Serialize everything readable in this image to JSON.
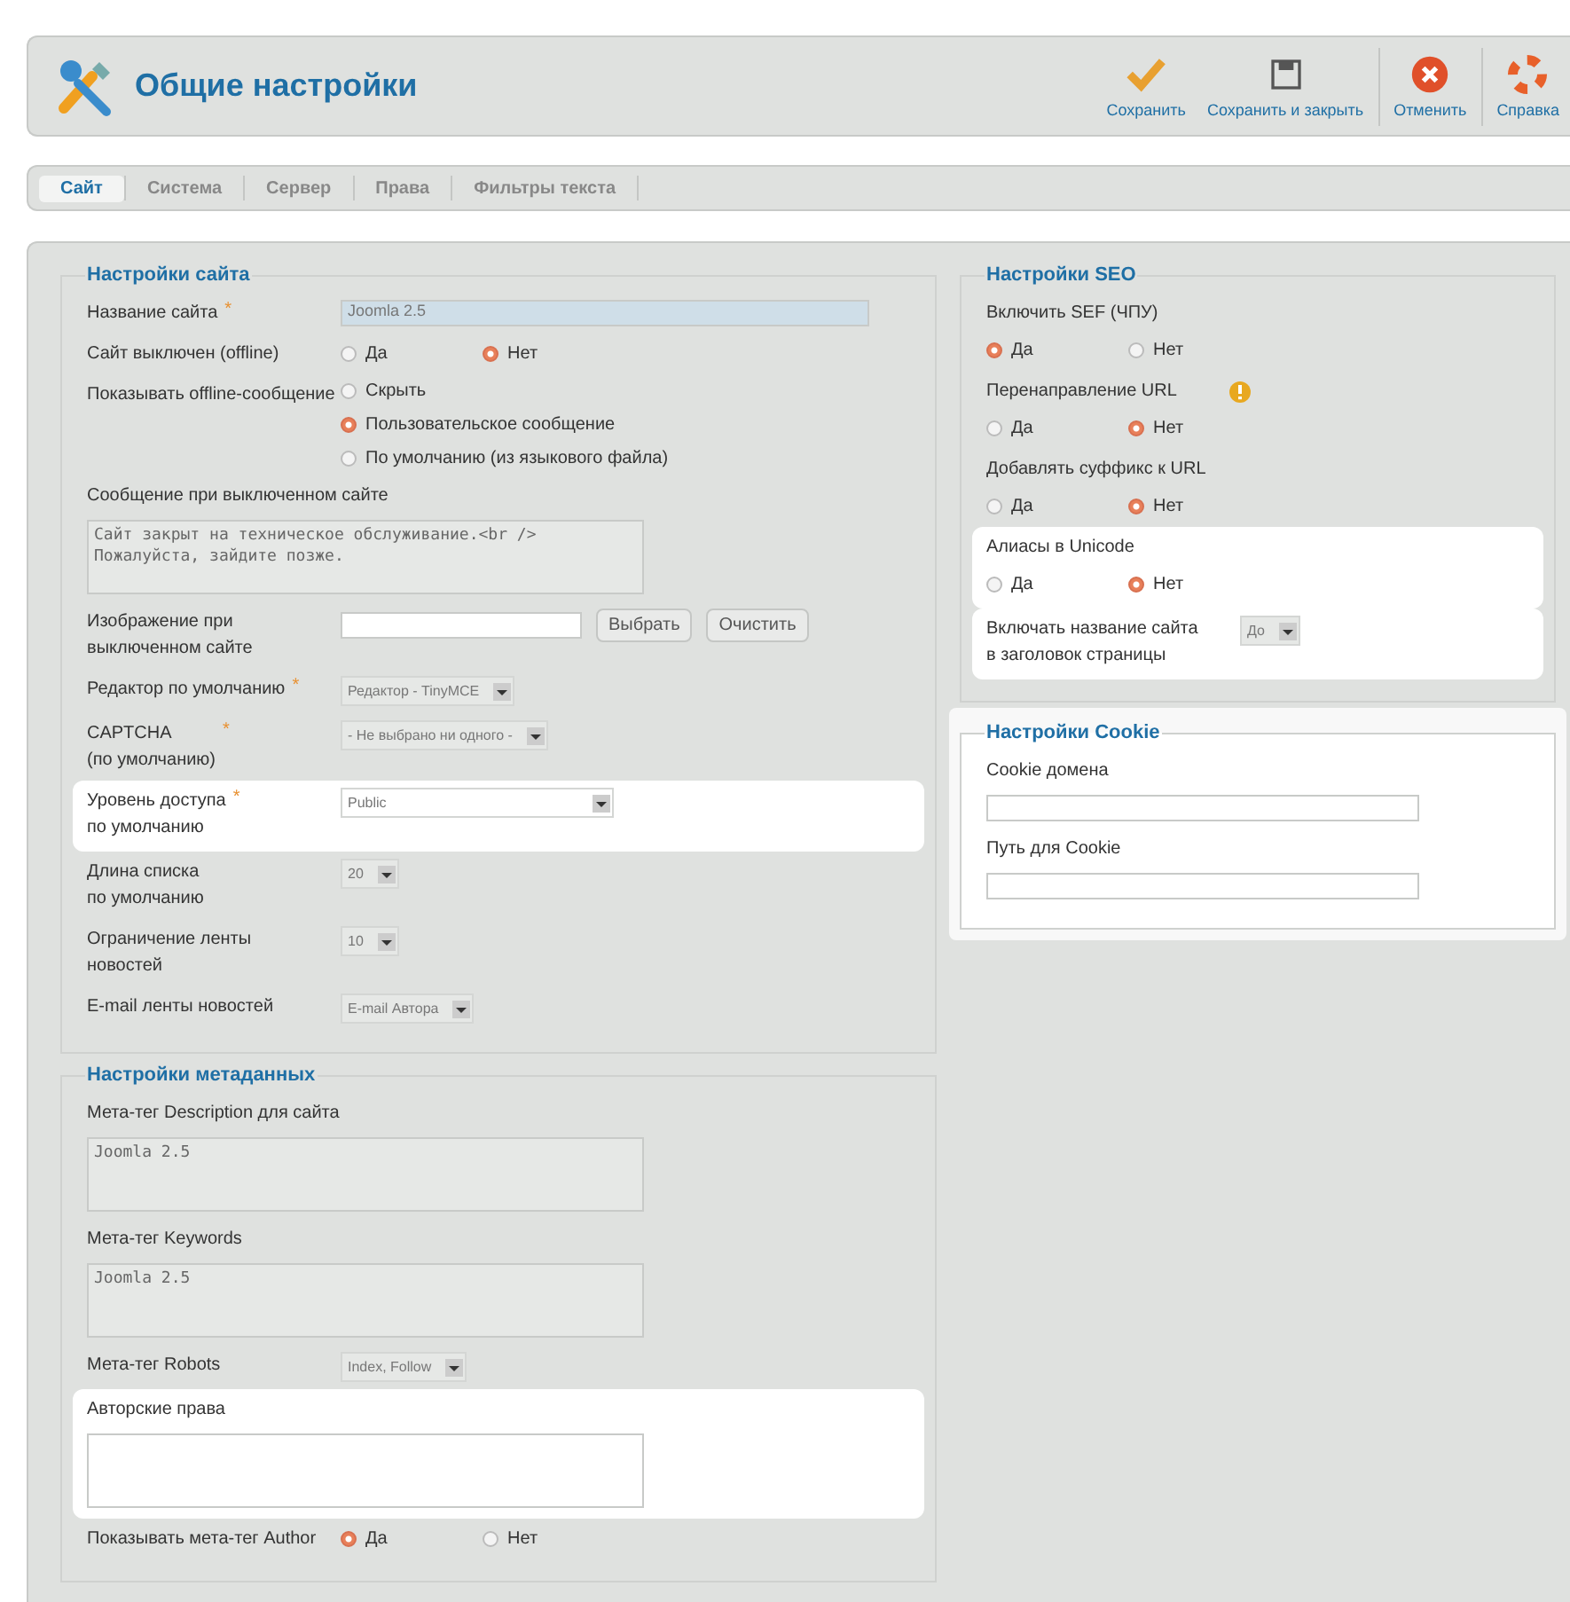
{
  "header": {
    "title": "Общие настройки",
    "toolbar": [
      {
        "kind": "save",
        "label": "Сохранить"
      },
      {
        "kind": "save-close",
        "label": "Сохранить и закрыть"
      },
      {
        "kind": "cancel",
        "label": "Отменить"
      },
      {
        "kind": "help",
        "label": "Справка"
      }
    ]
  },
  "tabs": [
    {
      "label": "Сайт",
      "selected": true
    },
    {
      "label": "Система",
      "selected": false
    },
    {
      "label": "Сервер",
      "selected": false
    },
    {
      "label": "Права",
      "selected": false
    },
    {
      "label": "Фильтры текста",
      "selected": false
    }
  ],
  "left_sections": [
    {
      "legend": "Настройки сайта",
      "highlighted": false,
      "fields": [
        {
          "kind": "text",
          "label": "Название сайта",
          "required": "*",
          "value": "Joomla 2.5"
        },
        {
          "kind": "radio",
          "label": "Сайт выключен (offline)",
          "options": [
            {
              "label": "Да",
              "selected": false
            },
            {
              "label": "Нет",
              "selected": true
            }
          ]
        },
        {
          "kind": "radio-list",
          "label": "Показывать offline-сообщение",
          "options": [
            {
              "label": "Скрыть",
              "selected": false
            },
            {
              "label": "Пользовательское сообщение",
              "selected": true
            },
            {
              "label": "По умолчанию (из языкового файла)",
              "selected": false
            }
          ]
        },
        {
          "kind": "textarea",
          "label": "Сообщение при выключенном сайте",
          "value": "Сайт закрыт на техническое обслуживание.<br />\nПожалуйста, зайдите позже."
        },
        {
          "kind": "image",
          "label": "Изображение при выключенном сайте",
          "buttons": [
            "Выбрать",
            "Очистить"
          ]
        },
        {
          "kind": "select",
          "label": "Редактор по умолчанию",
          "required": "*",
          "value": "Редактор - TinyMCE"
        },
        {
          "kind": "select",
          "label": "CAPTCHA\n(по умолчанию)",
          "required": "*",
          "value": "- Не выбрано ни одного -"
        },
        {
          "kind": "select",
          "label": "Уровень доступа\nпо умолчанию",
          "required": "*",
          "highlighted": true,
          "value": "Public"
        },
        {
          "kind": "select",
          "label": "Длина списка\nпо умолчанию",
          "value": "20"
        },
        {
          "kind": "select",
          "label": "Ограничение ленты\nновостей",
          "value": "10"
        },
        {
          "kind": "select",
          "label": "E-mail ленты новостей",
          "value": "E-mail Автора"
        }
      ]
    },
    {
      "legend": "Настройки метаданных",
      "highlighted": false,
      "fields": [
        {
          "kind": "textarea",
          "label": "Мета-тег Description для сайта",
          "value": "Joomla 2.5"
        },
        {
          "kind": "textarea",
          "label": "Мета-тег Keywords",
          "value": "Joomla 2.5"
        },
        {
          "kind": "select",
          "label": "Мета-тег Robots",
          "value": "Index, Follow"
        },
        {
          "kind": "textarea",
          "label": "Авторские права",
          "highlighted": true
        },
        {
          "kind": "radio",
          "label": "Показывать мета-тег Author",
          "options": [
            {
              "label": "Да",
              "selected": true
            },
            {
              "label": "Нет",
              "selected": false
            }
          ]
        }
      ]
    }
  ],
  "right_sections": [
    {
      "legend": "Настройки SEO",
      "highlighted": false,
      "fields": [
        {
          "kind": "radio-stacked",
          "label": "Включить SEF (ЧПУ)",
          "options": [
            {
              "label": "Да",
              "selected": true
            },
            {
              "label": "Нет",
              "selected": false
            }
          ]
        },
        {
          "kind": "radio-stacked",
          "label": "Перенаправление URL",
          "warning": true,
          "options": [
            {
              "label": "Да",
              "selected": false
            },
            {
              "label": "Нет",
              "selected": true
            }
          ]
        },
        {
          "kind": "radio-stacked",
          "label": "Добавлять суффикс к URL",
          "options": [
            {
              "label": "Да",
              "selected": false
            },
            {
              "label": "Нет",
              "selected": true
            }
          ]
        },
        {
          "kind": "radio-stacked",
          "label": "Алиасы в Unicode",
          "highlighted": true,
          "options": [
            {
              "label": "Да",
              "selected": false
            },
            {
              "label": "Нет",
              "selected": true
            }
          ]
        },
        {
          "kind": "select",
          "label": "Включать название сайта\nв заголовок страницы",
          "highlighted": true,
          "value": "До"
        }
      ]
    },
    {
      "legend": "Настройки Cookie",
      "highlighted": true,
      "fields": [
        {
          "kind": "text-stacked",
          "label": "Cookie домена"
        },
        {
          "kind": "text-stacked",
          "label": "Путь для Cookie"
        }
      ]
    }
  ]
}
